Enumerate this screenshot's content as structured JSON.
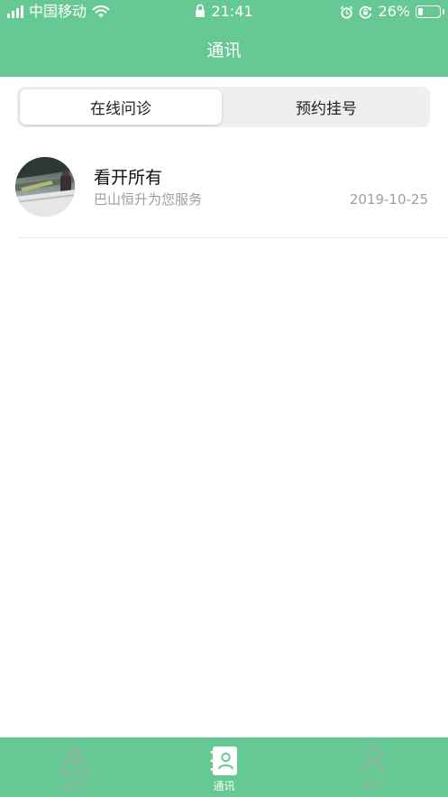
{
  "colors": {
    "brand": "#66c994",
    "text_primary": "#111111",
    "text_secondary": "#9e9e9e",
    "tab_inactive": "#8fb49f",
    "tab_active": "#ffffff"
  },
  "status_bar": {
    "carrier": "中国移动",
    "time": "21:41",
    "battery_percent": "26%",
    "battery_level": 0.26,
    "icons": [
      "signal-icon",
      "wifi-icon",
      "lock-icon",
      "alarm-icon",
      "orientation-lock-icon",
      "battery-icon"
    ]
  },
  "header": {
    "title": "通讯"
  },
  "segment": {
    "tabs": [
      {
        "label": "在线问诊",
        "selected": true
      },
      {
        "label": "预约挂号",
        "selected": false
      }
    ]
  },
  "conversations": [
    {
      "name": "看开所有",
      "preview": "巴山恒升为您服务",
      "date": "2019-10-25",
      "avatar_icon": "photo-avatar"
    }
  ],
  "tabbar": {
    "items": [
      {
        "label": "医疗",
        "icon": "doctor-icon",
        "active": false
      },
      {
        "label": "通讯",
        "icon": "contacts-book-icon",
        "active": true
      },
      {
        "label": "我的",
        "icon": "person-icon",
        "active": false
      }
    ]
  }
}
